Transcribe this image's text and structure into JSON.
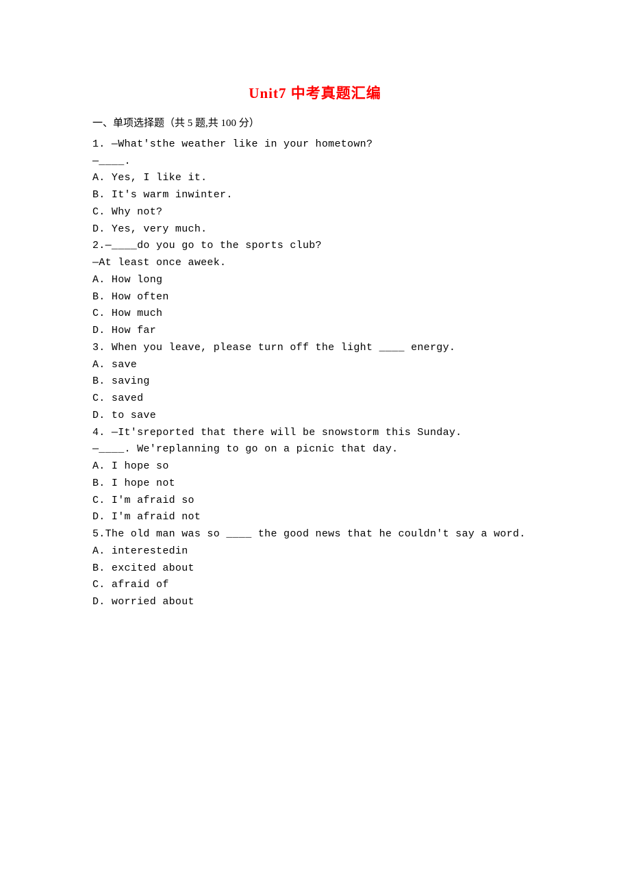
{
  "title": "Unit7 中考真题汇编",
  "section": "一、单项选择题（共 5 题,共 100 分）",
  "q1": {
    "prompt": "1. —What'sthe weather like in your hometown?",
    "response": "—____.",
    "a": "A. Yes, I like it.",
    "b": "B. It's warm inwinter.",
    "c": "C. Why not?",
    "d": "D. Yes, very much."
  },
  "q2": {
    "prompt": "2.—____do you go to the sports club?",
    "response": "—At least once aweek.",
    "a": "A. How long",
    "b": "B. How often",
    "c": "C. How much",
    "d": "D. How far"
  },
  "q3": {
    "prompt": "3. When you leave, please turn off the light ____ energy.",
    "a": "A. save",
    "b": "B. saving",
    "c": "C. saved",
    "d": "D. to save"
  },
  "q4": {
    "prompt": "4. —It'sreported that there will be snowstorm this Sunday.",
    "response": "—____. We'replanning to go on a picnic that day.",
    "a": "A. I hope so",
    "b": "B. I hope not",
    "c": "C. I'm afraid so",
    "d": "D. I'm afraid not"
  },
  "q5": {
    "prompt": "5.The old man was so ____ the good news that he couldn't say a word.",
    "a": "A. interestedin",
    "b": "B. excited about",
    "c": "C. afraid of",
    "d": "D. worried about"
  }
}
